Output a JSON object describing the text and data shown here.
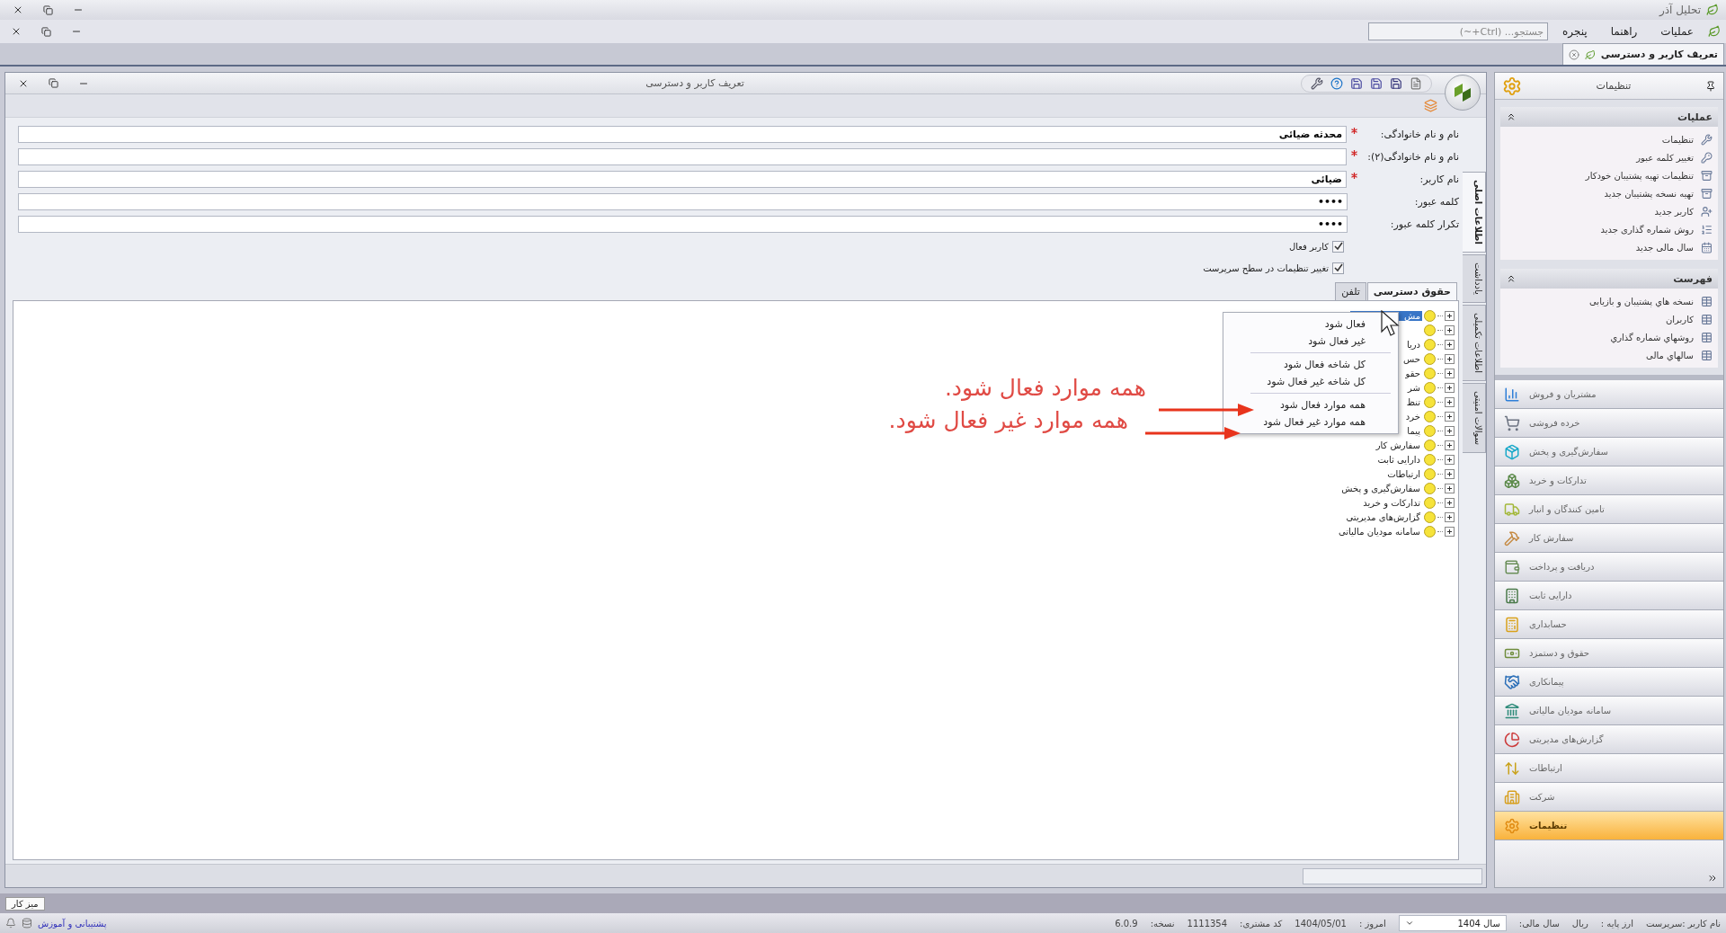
{
  "app_title": "تحلیل آذر",
  "menu": [
    "عملیات",
    "راهنما",
    "پنجره"
  ],
  "search": {
    "placeholder": "جستجو... (Ctrl+~)"
  },
  "doc_tabs": [
    {
      "label": "تعریف کاربر و دسترسی",
      "selected": true
    }
  ],
  "window": {
    "title": "تعریف کاربر و دسترسی"
  },
  "form": {
    "fields": [
      {
        "label": "نام و نام خانوادگی:",
        "required": true,
        "value": "محدثه ضیائی"
      },
      {
        "label": "نام و نام خانوادگی(۲):",
        "required": true
      },
      {
        "label": "نام کاربر:",
        "required": true,
        "value": "ضیائی"
      },
      {
        "label": "کلمه عبور:",
        "required": false,
        "value": "••••"
      },
      {
        "label": "تکرار کلمه عبور:",
        "required": false,
        "value": "••••"
      }
    ],
    "checkboxes": [
      {
        "label": "کاربر فعال",
        "checked": true
      },
      {
        "label": "تغییر تنظیمات در سطح سرپرست",
        "checked": true
      }
    ]
  },
  "side_tabs": [
    {
      "label": "اطلاعات اصلی",
      "selected": true
    },
    {
      "label": "یادداشت",
      "selected": false
    },
    {
      "label": "اطلاعات تکمیلی",
      "selected": false
    },
    {
      "label": "سوالات امنیتی",
      "selected": false
    }
  ],
  "inner_tabs": [
    {
      "label": "حقوق دسترسی",
      "selected": true
    },
    {
      "label": "تلفن",
      "selected": false
    }
  ],
  "tree": [
    {
      "label": "مش",
      "selected": true
    },
    {
      "selected": false
    },
    {
      "label": "دریا",
      "selected": false
    },
    {
      "label": "حس",
      "selected": false
    },
    {
      "label": "حقو",
      "selected": false
    },
    {
      "label": "شر",
      "selected": false
    },
    {
      "label": "تنظ",
      "selected": false
    },
    {
      "label": "خرد",
      "selected": false
    },
    {
      "label": "پیما",
      "selected": false
    },
    {
      "label": "سفارش کار",
      "selected": false
    },
    {
      "label": "دارایی ثابت",
      "selected": false
    },
    {
      "label": "ارتباطات",
      "selected": false
    },
    {
      "label": "سفارش‌گیری و پخش",
      "selected": false
    },
    {
      "label": "تدارکات و خرید",
      "selected": false
    },
    {
      "label": "گزارش‌های مدیریتی",
      "selected": false
    },
    {
      "label": "سامانه مودیان مالیاتی",
      "selected": false
    }
  ],
  "context_menu": {
    "groups": [
      [
        "فعال شود",
        "غیر فعال شود"
      ],
      [
        "کل شاخه فعال شود",
        "کل شاخه غیر فعال شود"
      ],
      [
        "همه موارد فعال شود",
        "همه موارد غیر فعال شود"
      ]
    ]
  },
  "annotations": [
    {
      "text": "همه موارد فعال شود."
    },
    {
      "text": "همه موارد غیر فعال شود."
    }
  ],
  "sidebar": {
    "title": "تنظیمات",
    "sections": [
      {
        "title": "عملیات",
        "expanded": true,
        "items": [
          "تنظیمات",
          "تغییر کلمه عبور",
          "تنظیمات تهیه پشتیبان خودکار",
          "تهیه نسخه پشتیبان جدید",
          "کاربر جدید",
          "روش شماره گذاری جدید",
          "سال مالی جدید"
        ]
      },
      {
        "title": "فهرست",
        "expanded": true,
        "items": [
          "نسخه هاي پشتيبان و بازيابی",
          "کاربران",
          "روشهاي شماره گذاري",
          "سالهاي مالی"
        ]
      }
    ],
    "modules": [
      {
        "label": "مشتریان و فروش",
        "selected": false
      },
      {
        "label": "خرده فروشی",
        "selected": false
      },
      {
        "label": "سفارش‌گیری و پخش",
        "selected": false
      },
      {
        "label": "تدارکات و خرید",
        "selected": false
      },
      {
        "label": "تامین کنندگان و انبار",
        "selected": false
      },
      {
        "label": "سفارش کار",
        "selected": false
      },
      {
        "label": "دریافت و پرداخت",
        "selected": false
      },
      {
        "label": "دارایی ثابت",
        "selected": false
      },
      {
        "label": "حسابداری",
        "selected": false
      },
      {
        "label": "حقوق و دستمزد",
        "selected": false
      },
      {
        "label": "پیمانکاری",
        "selected": false
      },
      {
        "label": "سامانه مودیان مالیاتی",
        "selected": false
      },
      {
        "label": "گزارش‌های مدیریتی",
        "selected": false
      },
      {
        "label": "ارتباطات",
        "selected": false
      },
      {
        "label": "شرکت",
        "selected": false
      },
      {
        "label": "تنظیمات",
        "selected": true
      }
    ]
  },
  "bottom_tabs": [
    {
      "label": "میز کار",
      "selected": true
    }
  ],
  "status_bar": {
    "items": [
      {
        "kind": "text",
        "text": "نام کاربر :سرپرست"
      },
      {
        "kind": "text",
        "text": "ارز پایه :"
      },
      {
        "kind": "text",
        "text": "ریال"
      },
      {
        "kind": "text",
        "text": "سال مالی:"
      },
      {
        "kind": "select",
        "text": "سال 1404"
      },
      {
        "kind": "text",
        "text": "امروز :"
      },
      {
        "kind": "text",
        "text": "1404/05/01"
      },
      {
        "kind": "text",
        "text": "کد مشتری:"
      },
      {
        "kind": "text",
        "text": "1111354"
      },
      {
        "kind": "text",
        "text": "نسخه:"
      },
      {
        "kind": "text",
        "text": "6.0.9"
      }
    ],
    "link": "پشتیبانی و آموزش"
  }
}
